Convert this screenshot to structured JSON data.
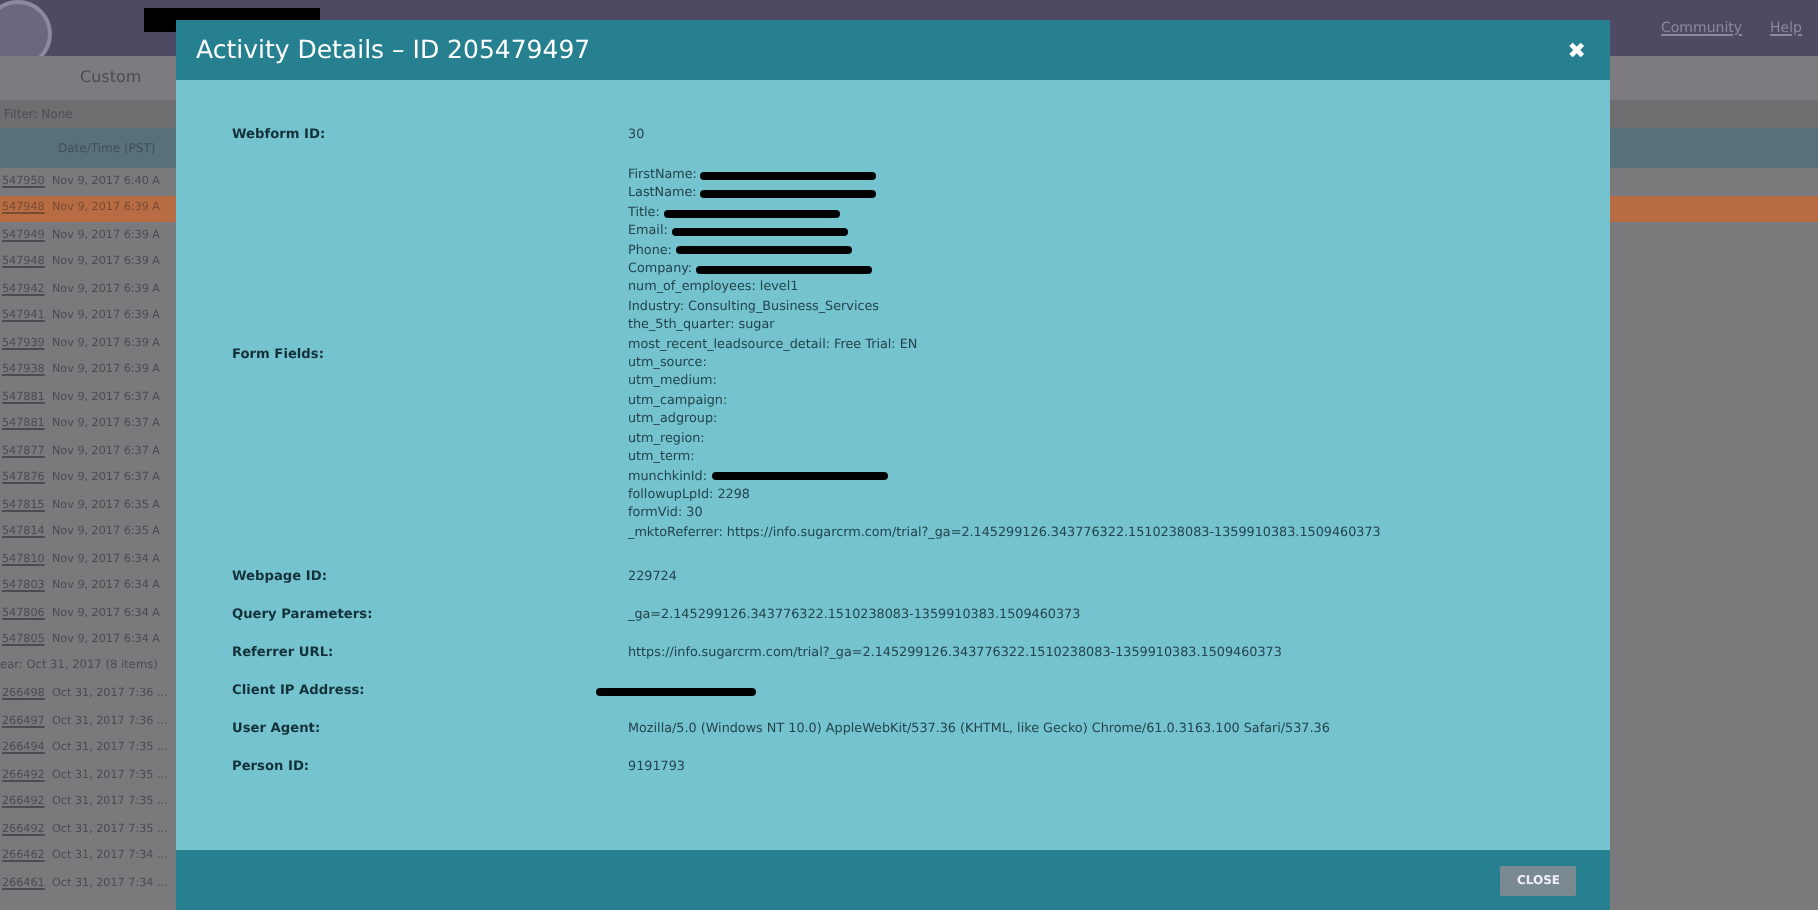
{
  "app_header": {
    "title_redacted": true,
    "nav_links": [
      "Community",
      "Help"
    ],
    "tab": "Custom"
  },
  "filter": "Filter: None",
  "table": {
    "columns": [
      "Date/Time (PST)"
    ],
    "rows": [
      {
        "kind": "row",
        "id": "547950",
        "time": "Nov 9, 2017 6:40 A",
        "selected": false
      },
      {
        "kind": "row",
        "id": "547948",
        "time": "Nov 9, 2017 6:39 A",
        "selected": true
      },
      {
        "kind": "row",
        "id": "547949",
        "time": "Nov 9, 2017 6:39 A",
        "selected": false
      },
      {
        "kind": "row",
        "id": "547948",
        "time": "Nov 9, 2017 6:39 A",
        "selected": false
      },
      {
        "kind": "row",
        "id": "547942",
        "time": "Nov 9, 2017 6:39 A",
        "selected": false
      },
      {
        "kind": "row",
        "id": "547941",
        "time": "Nov 9, 2017 6:39 A",
        "selected": false
      },
      {
        "kind": "row",
        "id": "547939",
        "time": "Nov 9, 2017 6:39 A",
        "selected": false
      },
      {
        "kind": "row",
        "id": "547938",
        "time": "Nov 9, 2017 6:39 A",
        "selected": false
      },
      {
        "kind": "row",
        "id": "547881",
        "time": "Nov 9, 2017 6:37 A",
        "selected": false
      },
      {
        "kind": "row",
        "id": "547881",
        "time": "Nov 9, 2017 6:37 A",
        "selected": false
      },
      {
        "kind": "row",
        "id": "547877",
        "time": "Nov 9, 2017 6:37 A",
        "selected": false
      },
      {
        "kind": "row",
        "id": "547876",
        "time": "Nov 9, 2017 6:37 A",
        "selected": false
      },
      {
        "kind": "row",
        "id": "547815",
        "time": "Nov 9, 2017 6:35 A",
        "selected": false
      },
      {
        "kind": "row",
        "id": "547814",
        "time": "Nov 9, 2017 6:35 A",
        "selected": false
      },
      {
        "kind": "row",
        "id": "547810",
        "time": "Nov 9, 2017 6:34 A",
        "selected": false
      },
      {
        "kind": "row",
        "id": "547803",
        "time": "Nov 9, 2017 6:34 A",
        "selected": false
      },
      {
        "kind": "row",
        "id": "547806",
        "time": "Nov 9, 2017 6:34 A",
        "selected": false
      },
      {
        "kind": "row",
        "id": "547805",
        "time": "Nov 9, 2017 6:34 A",
        "selected": false
      },
      {
        "kind": "group",
        "text": "ear: Oct 31, 2017 (8 items)"
      },
      {
        "kind": "row",
        "id": "266498",
        "time": "Oct 31, 2017 7:36 ...",
        "selected": false
      },
      {
        "kind": "row",
        "id": "266497",
        "time": "Oct 31, 2017 7:36 ...",
        "selected": false
      },
      {
        "kind": "row",
        "id": "266494",
        "time": "Oct 31, 2017 7:35 ...",
        "selected": false
      },
      {
        "kind": "row",
        "id": "266492",
        "time": "Oct 31, 2017 7:35 ...",
        "selected": false
      },
      {
        "kind": "row",
        "id": "266492",
        "time": "Oct 31, 2017 7:35 ...",
        "selected": false
      },
      {
        "kind": "row",
        "id": "266492",
        "time": "Oct 31, 2017 7:35 ...",
        "selected": false
      },
      {
        "kind": "row",
        "id": "266462",
        "time": "Oct 31, 2017 7:34 ...",
        "selected": false
      },
      {
        "kind": "row",
        "id": "266461",
        "time": "Oct 31, 2017 7:34 ...",
        "selected": false
      }
    ]
  },
  "modal": {
    "title": "Activity Details – ID 205479497",
    "close_glyph": "✖",
    "fields": [
      {
        "kind": "text",
        "label": "Webform ID:",
        "value": "30"
      },
      {
        "kind": "lines",
        "label": "Form Fields:",
        "lines": [
          {
            "text": "FirstName:",
            "redacted": true
          },
          {
            "text": "LastName:",
            "redacted": true
          },
          {
            "text": "Title:",
            "redacted": true
          },
          {
            "text": "Email:",
            "redacted": true
          },
          {
            "text": "Phone:",
            "redacted": true
          },
          {
            "text": "Company:",
            "redacted": true
          },
          {
            "text": "num_of_employees: level1",
            "redacted": false
          },
          {
            "text": "Industry: Consulting_Business_Services",
            "redacted": false
          },
          {
            "text": "the_5th_quarter: sugar",
            "redacted": false
          },
          {
            "text": "most_recent_leadsource_detail: Free Trial: EN",
            "redacted": false
          },
          {
            "text": "utm_source:",
            "redacted": false
          },
          {
            "text": "utm_medium:",
            "redacted": false
          },
          {
            "text": "utm_campaign:",
            "redacted": false
          },
          {
            "text": "utm_adgroup:",
            "redacted": false
          },
          {
            "text": "utm_region:",
            "redacted": false
          },
          {
            "text": "utm_term:",
            "redacted": false
          },
          {
            "text": "munchkinId:",
            "redacted": true
          },
          {
            "text": "followupLpId: 2298",
            "redacted": false
          },
          {
            "text": "formVid: 30",
            "redacted": false
          },
          {
            "text": "_mktoReferrer: https://info.sugarcrm.com/trial?_ga=2.145299126.343776322.1510238083-1359910383.1509460373",
            "redacted": false
          }
        ]
      },
      {
        "kind": "text",
        "label": "Webpage ID:",
        "value": "229724"
      },
      {
        "kind": "text",
        "label": "Query Parameters:",
        "value": "_ga=2.145299126.343776322.1510238083-1359910383.1509460373"
      },
      {
        "kind": "text",
        "label": "Referrer URL:",
        "value": "https://info.sugarcrm.com/trial?_ga=2.145299126.343776322.1510238083-1359910383.1509460373"
      },
      {
        "kind": "redacted",
        "label": "Client IP Address:"
      },
      {
        "kind": "text",
        "label": "User Agent:",
        "value": "Mozilla/5.0 (Windows NT 10.0) AppleWebKit/537.36 (KHTML, like Gecko) Chrome/61.0.3163.100 Safari/537.36"
      },
      {
        "kind": "text",
        "label": "Person ID:",
        "value": "9191793"
      }
    ],
    "button": "CLOSE"
  }
}
